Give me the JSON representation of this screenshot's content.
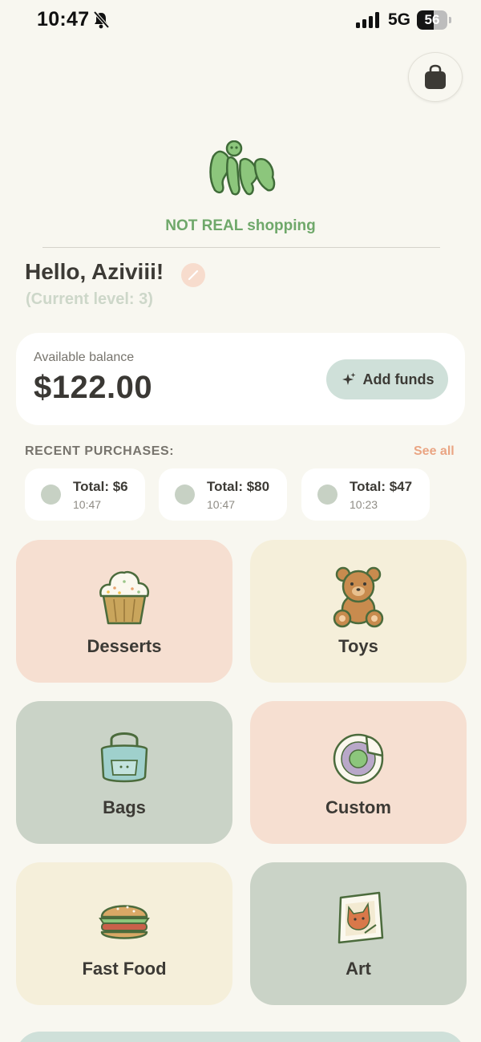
{
  "status_bar": {
    "time": "10:47",
    "network": "5G",
    "battery_percent": "56",
    "battery_level": 0.56,
    "icons": [
      "bell-slash-icon",
      "signal-icon",
      "battery-icon"
    ]
  },
  "header": {
    "cart_icon": "shopping-bag-icon",
    "tagline": "NOT REAL shopping"
  },
  "greeting": {
    "text": "Hello, Aziviii!",
    "level": "(Current level: 3)",
    "edit_icon": "pencil-icon"
  },
  "balance": {
    "label": "Available balance",
    "amount": "$122.00",
    "add_funds_label": "Add funds",
    "add_funds_icon": "sparkle-icon"
  },
  "recent": {
    "title": "RECENT PURCHASES:",
    "see_all": "See all",
    "items": [
      {
        "total": "Total: $6",
        "time": "10:47"
      },
      {
        "total": "Total: $80",
        "time": "10:47"
      },
      {
        "total": "Total: $47",
        "time": "10:23"
      }
    ]
  },
  "categories": [
    {
      "label": "Desserts",
      "icon": "cupcake-icon"
    },
    {
      "label": "Toys",
      "icon": "teddy-bear-icon"
    },
    {
      "label": "Bags",
      "icon": "tote-bag-icon"
    },
    {
      "label": "Custom",
      "icon": "sticker-icon"
    },
    {
      "label": "Fast Food",
      "icon": "burger-icon"
    },
    {
      "label": "Art",
      "icon": "art-print-icon"
    }
  ],
  "colors": {
    "background": "#f8f7f0",
    "accent_green": "#6fa86a",
    "accent_peach": "#eaa583",
    "card_peach": "#f6dfd1",
    "card_cream": "#f5efda",
    "card_sage": "#cad3c7",
    "card_mint": "#cfe0d9"
  }
}
